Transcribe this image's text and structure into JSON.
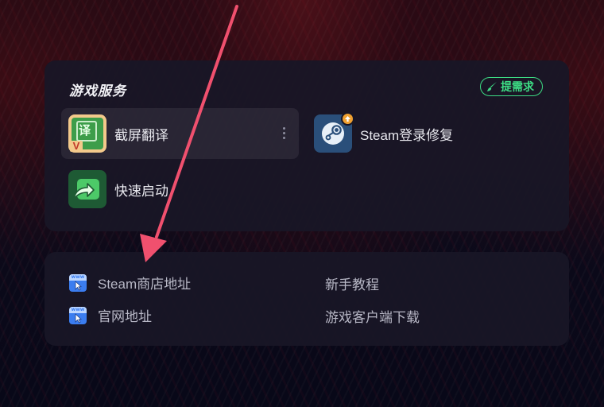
{
  "services": {
    "title": "游戏服务",
    "request_button": "提需求",
    "items": [
      {
        "label": "截屏翻译",
        "icon": "screenshot-translate-icon",
        "icon_char": "译",
        "badge": "V"
      },
      {
        "label": "Steam登录修复",
        "icon": "steam-login-repair-icon"
      },
      {
        "label": "快速启动",
        "icon": "quick-launch-icon"
      }
    ]
  },
  "links": {
    "items": [
      {
        "label": "Steam商店地址",
        "icon": "www-icon"
      },
      {
        "label": "新手教程"
      },
      {
        "label": "官网地址",
        "icon": "www-icon"
      },
      {
        "label": "游戏客户端下载"
      }
    ],
    "www_label": "www"
  },
  "colors": {
    "accent_green": "#3ddc84",
    "annotation_arrow": "#f0506e",
    "card_bg": "#181626"
  }
}
